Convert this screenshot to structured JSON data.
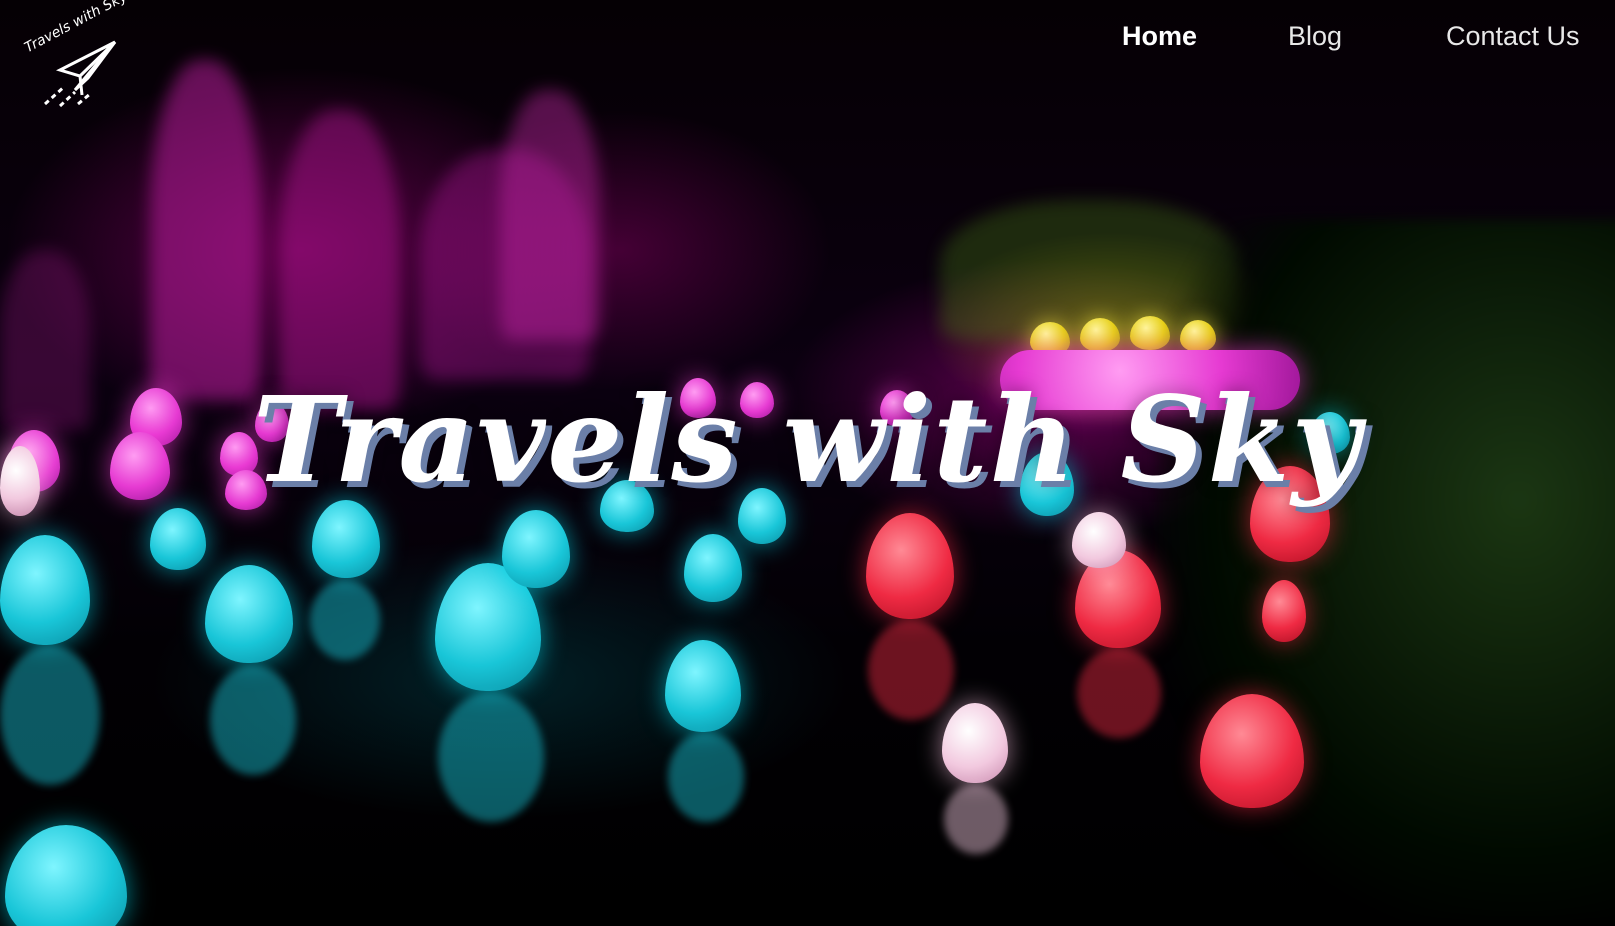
{
  "brand": {
    "logo_text": "Travels with Sky",
    "icon": "paper-plane-icon"
  },
  "nav": {
    "items": [
      {
        "label": "Home",
        "active": true
      },
      {
        "label": "Blog",
        "active": false
      },
      {
        "label": "Contact Us",
        "active": false
      }
    ]
  },
  "hero": {
    "title": "Travels with Sky"
  }
}
